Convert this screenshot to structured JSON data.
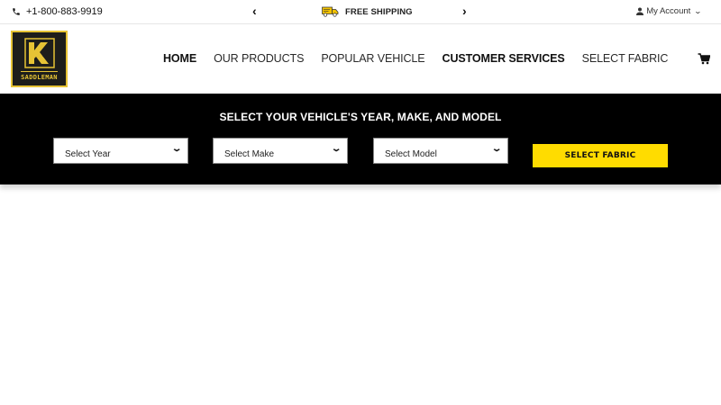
{
  "topbar": {
    "phone": "+1-800-883-9919",
    "promo_text": "FREE SHIPPING",
    "promo_prev": "‹",
    "promo_next": "›",
    "account_label": "My Account"
  },
  "header": {
    "logo_text": "SADDLEMAN",
    "nav": [
      "HOME",
      "OUR PRODUCTS",
      "POPULAR VEHICLE",
      "CUSTOMER SERVICES",
      "SELECT FABRIC"
    ]
  },
  "selector": {
    "title": "SELECT YOUR VEHICLE'S YEAR, MAKE, AND MODEL",
    "year_value": "Select Year",
    "make_value": "Select Make",
    "model_value": "Select Model",
    "button_label": "SELECT FABRIC"
  },
  "colors": {
    "accent": "#ffdc00",
    "band": "#000000",
    "logo_gold": "#e6c335"
  },
  "icons": [
    "phone-icon",
    "truck-icon",
    "user-icon",
    "chevron-down-icon",
    "cart-icon"
  ]
}
